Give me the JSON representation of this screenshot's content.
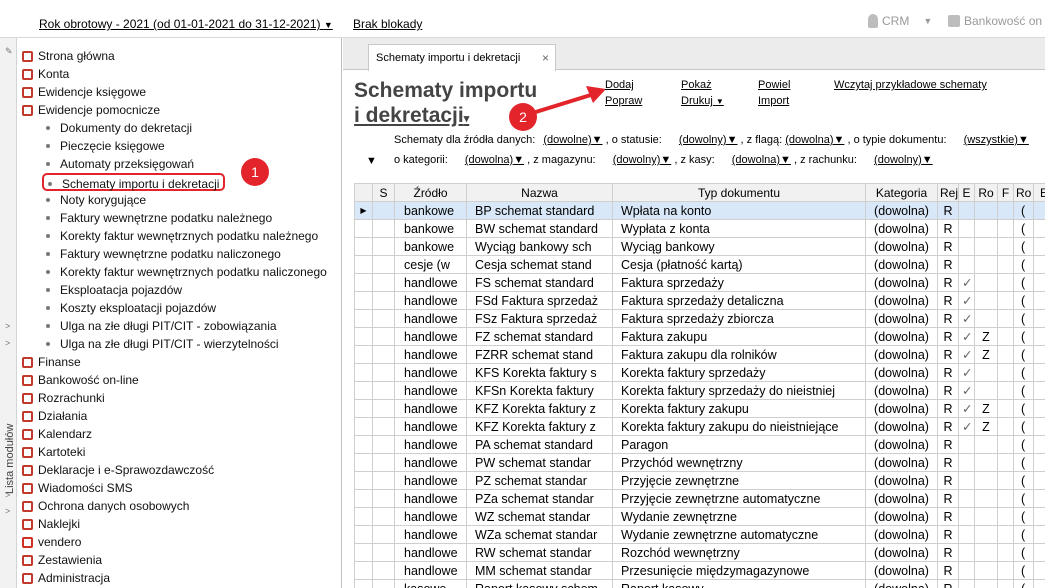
{
  "topbar": {
    "period": "Rok obrotowy - 2021  (od 01-01-2021 do 31-12-2021)",
    "lock": "Brak blokady",
    "crm": "CRM",
    "bank": "Bankowość on"
  },
  "rail": {
    "label": "Lista modułów"
  },
  "tree": [
    {
      "label": "Strona główna",
      "icon": "house-icon",
      "level": 0,
      "color": "#c0392b"
    },
    {
      "label": "Konta",
      "icon": "accounts-icon",
      "level": 0,
      "color": "#c0392b"
    },
    {
      "label": "Ewidencje księgowe",
      "icon": "ledger-icon",
      "level": 0,
      "color": "#c0392b"
    },
    {
      "label": "Ewidencje pomocnicze",
      "icon": "aux-ledger-icon",
      "level": 0,
      "color": "#c0392b"
    },
    {
      "label": "Dokumenty do dekretacji",
      "level": 1
    },
    {
      "label": "Pieczęcie księgowe",
      "level": 1
    },
    {
      "label": "Automaty przeksięgowań",
      "level": 1
    },
    {
      "label": "Schematy importu i dekretacji",
      "level": 1,
      "selected": true
    },
    {
      "label": "Noty korygujące",
      "level": 1
    },
    {
      "label": "Faktury wewnętrzne podatku należnego",
      "level": 1
    },
    {
      "label": "Korekty faktur wewnętrznych podatku należnego",
      "level": 1
    },
    {
      "label": "Faktury wewnętrzne podatku naliczonego",
      "level": 1
    },
    {
      "label": "Korekty faktur wewnętrznych podatku naliczonego",
      "level": 1
    },
    {
      "label": "Eksploatacja pojazdów",
      "level": 1
    },
    {
      "label": "Koszty eksploatacji pojazdów",
      "level": 1
    },
    {
      "label": "Ulga na złe długi PIT/CIT - zobowiązania",
      "level": 1
    },
    {
      "label": "Ulga na złe długi PIT/CIT - wierzytelności",
      "level": 1
    },
    {
      "label": "Finanse",
      "icon": "finance-icon",
      "level": 0,
      "color": "#c0392b"
    },
    {
      "label": "Bankowość on-line",
      "icon": "bank-icon",
      "level": 0,
      "color": "#c0392b"
    },
    {
      "label": "Rozrachunki",
      "icon": "settlements-icon",
      "level": 0,
      "color": "#c0392b"
    },
    {
      "label": "Działania",
      "icon": "actions-icon",
      "level": 0,
      "color": "#c0392b"
    },
    {
      "label": "Kalendarz",
      "icon": "calendar-icon",
      "level": 0,
      "color": "#c0392b"
    },
    {
      "label": "Kartoteki",
      "icon": "files-icon",
      "level": 0,
      "color": "#c0392b"
    },
    {
      "label": "Deklaracje i e-Sprawozdawczość",
      "icon": "declarations-icon",
      "level": 0,
      "color": "#c0392b"
    },
    {
      "label": "Wiadomości SMS",
      "icon": "sms-icon",
      "level": 0,
      "color": "#c0392b"
    },
    {
      "label": "Ochrona danych osobowych",
      "icon": "privacy-icon",
      "level": 0,
      "color": "#c0392b"
    },
    {
      "label": "Naklejki",
      "icon": "stickers-icon",
      "level": 0,
      "color": "#c0392b"
    },
    {
      "label": "vendero",
      "icon": "vendero-icon",
      "level": 0,
      "color": "#d03020"
    },
    {
      "label": "Zestawienia",
      "icon": "reports-icon",
      "level": 0,
      "color": "#c0392b"
    },
    {
      "label": "Administracja",
      "icon": "admin-icon",
      "level": 0,
      "color": "#c0392b"
    }
  ],
  "badges": [
    "1",
    "2"
  ],
  "tab": {
    "label": "Schematy importu i dekretacji",
    "close": "×"
  },
  "page": {
    "title_line1": "Schematy importu",
    "title_line2": "i dekretacji"
  },
  "actions": {
    "dodaj": "Dodaj",
    "popraw": "Popraw",
    "pokaz": "Pokaż",
    "drukuj": "Drukuj",
    "powiel": "Powiel",
    "import": "Import",
    "wczytaj": "Wczytaj przykładowe schematy"
  },
  "filters": {
    "row1_label": "Schematy dla źródła danych:",
    "source": "(dowolne)",
    "status_label": ", o statusie:",
    "status": "(dowolny)",
    "flag_label": ", z flagą:",
    "flag": "(dowolna)",
    "doctype_label": ", o typie dokumentu:",
    "doctype": "(wszystkie)",
    "category_label": "o kategorii:",
    "category": "(dowolna)",
    "warehouse_label": ", z magazynu:",
    "warehouse": "(dowolny)",
    "cash_label": ", z kasy:",
    "cash": "(dowolna)",
    "account_label": ", z rachunku:",
    "account": "(dowolny)"
  },
  "grid": {
    "headers": [
      "",
      "S",
      "Źródło",
      "Nazwa",
      "Typ dokumentu",
      "Kategoria",
      "Rej",
      "E",
      "Ro",
      "F",
      "Ro",
      "E"
    ],
    "rows": [
      [
        "bankowe",
        "BP schemat standard",
        "Wpłata na konto",
        "(dowolna)",
        "R",
        "",
        "",
        "("
      ],
      [
        "bankowe",
        "BW schemat standard",
        "Wypłata z konta",
        "(dowolna)",
        "R",
        "",
        "",
        "("
      ],
      [
        "bankowe",
        "Wyciąg bankowy sch",
        "Wyciąg bankowy",
        "(dowolna)",
        "R",
        "",
        "",
        "("
      ],
      [
        "cesje (w",
        "Cesja schemat stand",
        "Cesja (płatność kartą)",
        "(dowolna)",
        "R",
        "",
        "",
        "("
      ],
      [
        "handlowe",
        "FS schemat standard",
        "Faktura sprzedaży",
        "(dowolna)",
        "R",
        "✓",
        "",
        "("
      ],
      [
        "handlowe",
        "FSd Faktura sprzedaż",
        "Faktura sprzedaży detaliczna",
        "(dowolna)",
        "R",
        "✓",
        "",
        "("
      ],
      [
        "handlowe",
        "FSz Faktura sprzedaż",
        "Faktura sprzedaży zbiorcza",
        "(dowolna)",
        "R",
        "✓",
        "",
        "("
      ],
      [
        "handlowe",
        "FZ schemat standard",
        "Faktura zakupu",
        "(dowolna)",
        "R",
        "✓",
        "Z",
        "("
      ],
      [
        "handlowe",
        "FZRR schemat stand",
        "Faktura zakupu dla rolników",
        "(dowolna)",
        "R",
        "✓",
        "Z",
        "("
      ],
      [
        "handlowe",
        "KFS Korekta faktury s",
        "Korekta faktury sprzedaży",
        "(dowolna)",
        "R",
        "✓",
        "",
        "("
      ],
      [
        "handlowe",
        "KFSn Korekta faktury",
        "Korekta faktury sprzedaży do nieistniej",
        "(dowolna)",
        "R",
        "✓",
        "",
        "("
      ],
      [
        "handlowe",
        "KFZ Korekta faktury z",
        "Korekta faktury zakupu",
        "(dowolna)",
        "R",
        "✓",
        "Z",
        "("
      ],
      [
        "handlowe",
        "KFZ Korekta faktury z",
        "Korekta faktury zakupu do nieistniejące",
        "(dowolna)",
        "R",
        "✓",
        "Z",
        "("
      ],
      [
        "handlowe",
        "PA schemat standard",
        "Paragon",
        "(dowolna)",
        "R",
        "",
        "",
        "("
      ],
      [
        "handlowe",
        "PW schemat standar",
        "Przychód wewnętrzny",
        "(dowolna)",
        "R",
        "",
        "",
        "("
      ],
      [
        "handlowe",
        "PZ schemat standar",
        "Przyjęcie zewnętrzne",
        "(dowolna)",
        "R",
        "",
        "",
        "("
      ],
      [
        "handlowe",
        "PZa schemat standar",
        "Przyjęcie zewnętrzne automatyczne",
        "(dowolna)",
        "R",
        "",
        "",
        "("
      ],
      [
        "handlowe",
        "WZ schemat standar",
        "Wydanie zewnętrzne",
        "(dowolna)",
        "R",
        "",
        "",
        "("
      ],
      [
        "handlowe",
        "WZa schemat standar",
        "Wydanie zewnętrzne automatyczne",
        "(dowolna)",
        "R",
        "",
        "",
        "("
      ],
      [
        "handlowe",
        "RW schemat standar",
        "Rozchód wewnętrzny",
        "(dowolna)",
        "R",
        "",
        "",
        "("
      ],
      [
        "handlowe",
        "MM schemat standar",
        "Przesunięcie międzymagazynowe",
        "(dowolna)",
        "R",
        "",
        "",
        "("
      ],
      [
        "kasowe",
        "Raport kasowy schem",
        "Raport kasowy",
        "(dowolna)",
        "R",
        "",
        "",
        "("
      ]
    ]
  }
}
